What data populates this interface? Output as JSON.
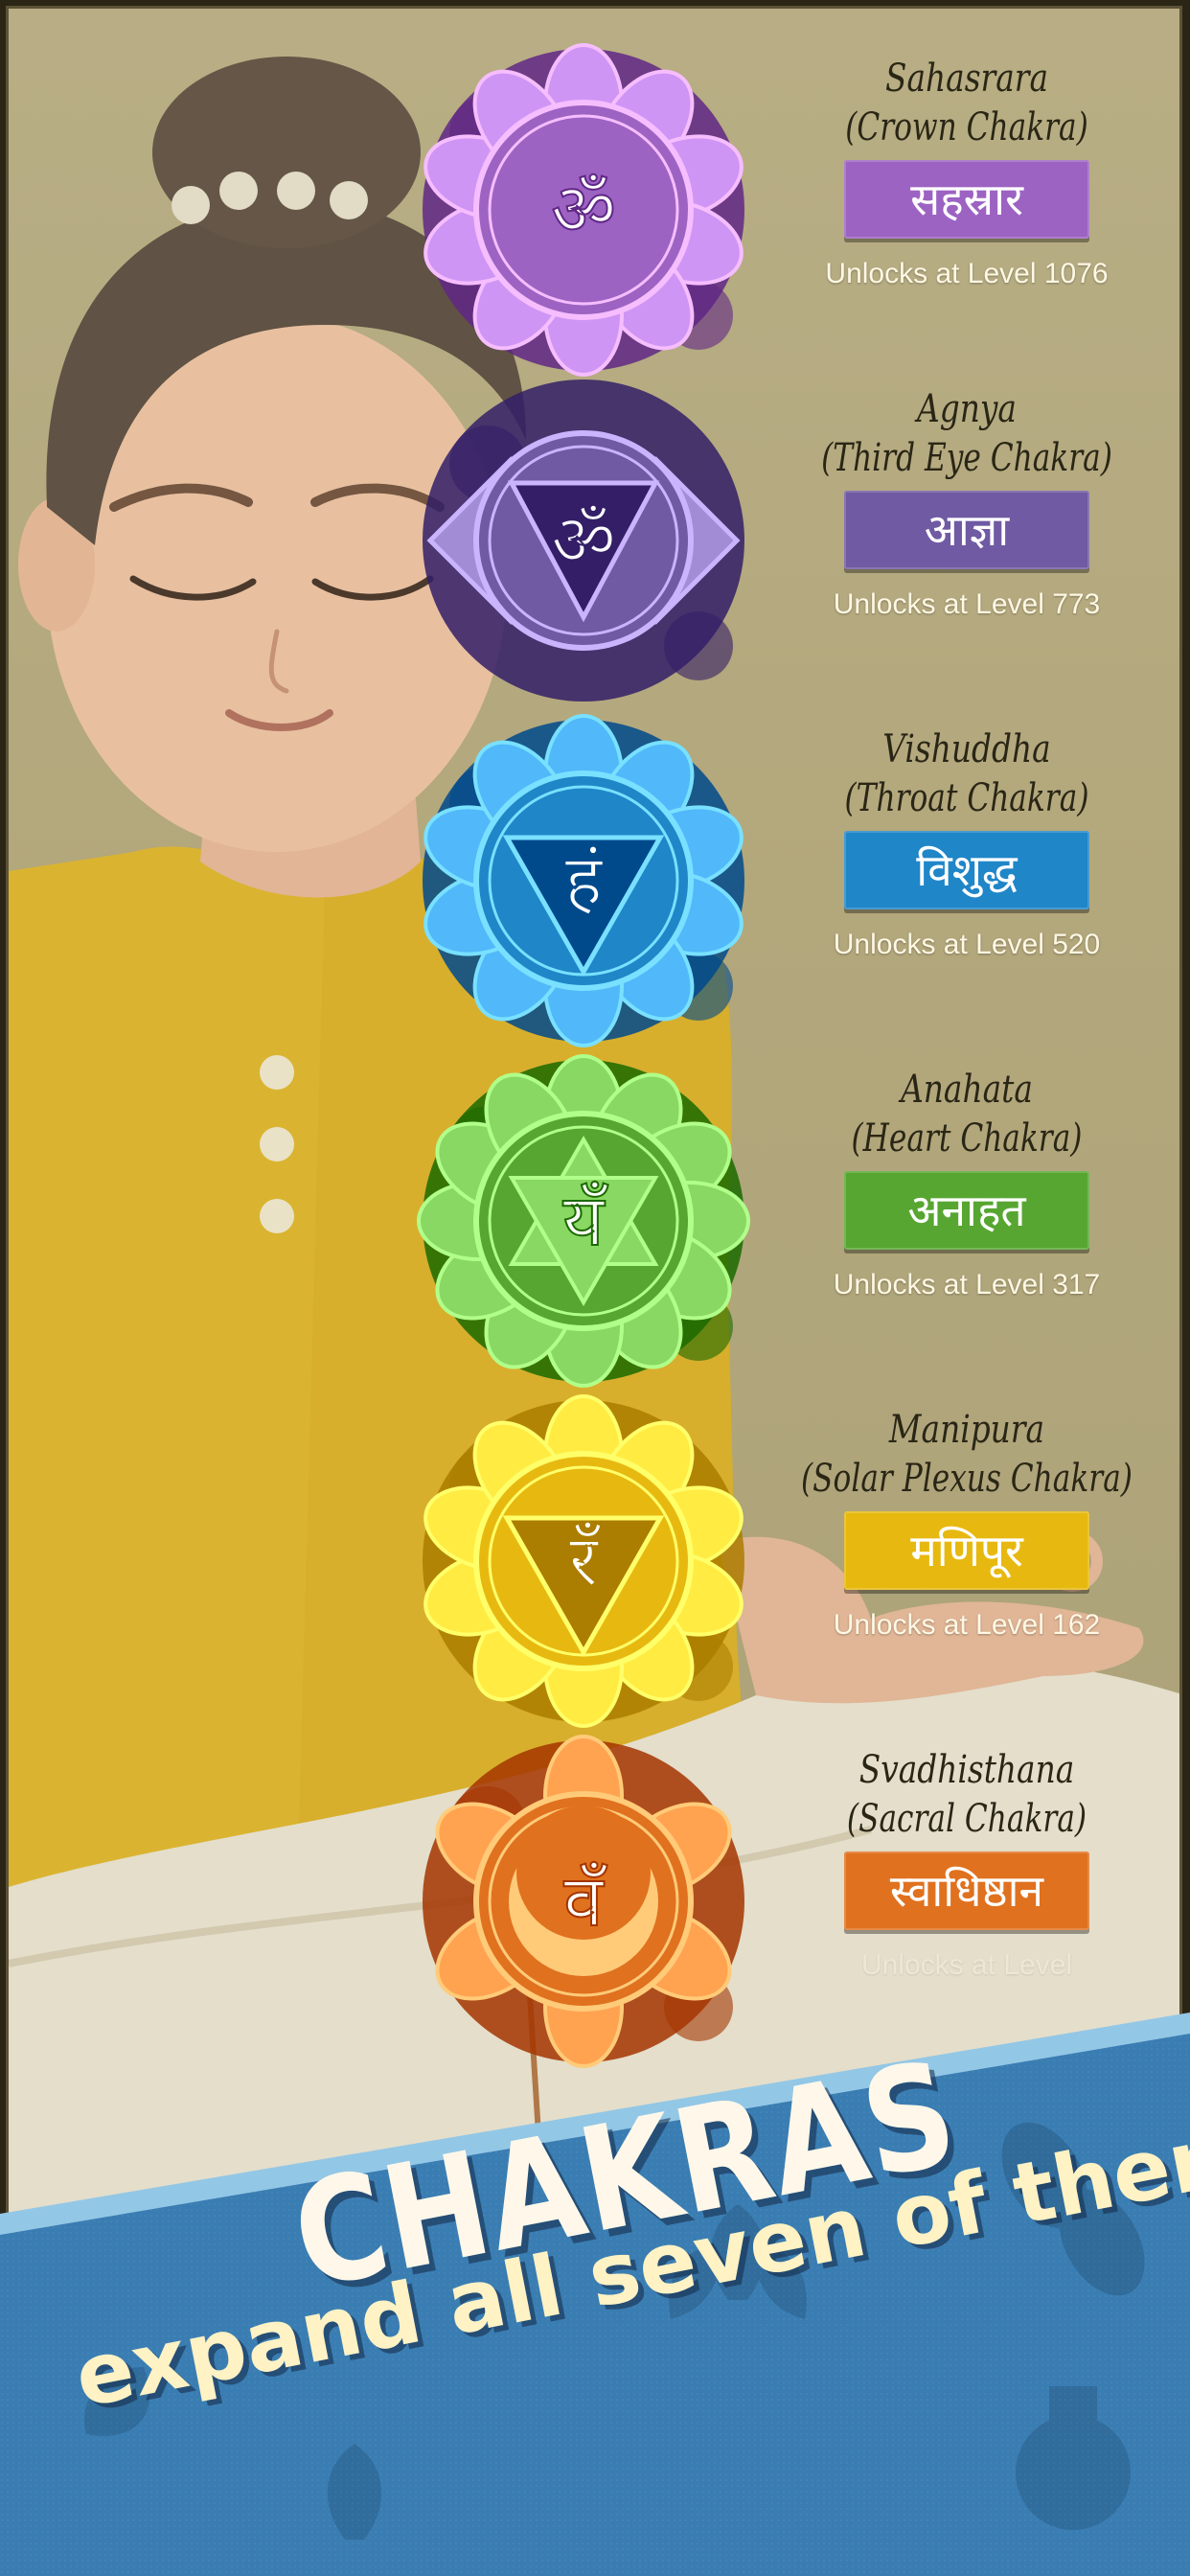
{
  "colors": {
    "banner_blue": "#3b7fb3",
    "banner_edge": "#93c7e6",
    "crown": "#9c63c2",
    "third_eye": "#6f5aa3",
    "throat": "#1f86c8",
    "heart": "#57a631",
    "solar": "#e7b910",
    "sacral": "#e0711f"
  },
  "chakras": [
    {
      "name": "Sahasrara",
      "subtitle": "(Crown Chakra)",
      "sanskrit": "सहस्रार",
      "unlock": "Unlocks at Level 1076",
      "symbol": "ॐ",
      "color": "#9c63c2",
      "icon": "crown-chakra-icon"
    },
    {
      "name": "Agnya",
      "subtitle": "(Third Eye Chakra)",
      "sanskrit": "आज्ञा",
      "unlock": "Unlocks at Level 773",
      "symbol": "ॐ",
      "color": "#6f5aa3",
      "icon": "third-eye-chakra-icon"
    },
    {
      "name": "Vishuddha",
      "subtitle": "(Throat Chakra)",
      "sanskrit": "विशुद्ध",
      "unlock": "Unlocks at Level 520",
      "symbol": "हं",
      "color": "#1f86c8",
      "icon": "throat-chakra-icon"
    },
    {
      "name": "Anahata",
      "subtitle": "(Heart Chakra)",
      "sanskrit": "अनाहत",
      "unlock": "Unlocks at Level 317",
      "symbol": "यँ",
      "color": "#57a631",
      "icon": "heart-chakra-icon"
    },
    {
      "name": "Manipura",
      "subtitle": "(Solar Plexus Chakra)",
      "sanskrit": "मणिपूर",
      "unlock": "Unlocks at Level 162",
      "symbol": "रँ",
      "color": "#e7b910",
      "icon": "solar-plexus-chakra-icon"
    },
    {
      "name": "Svadhisthana",
      "subtitle": "(Sacral Chakra)",
      "sanskrit": "स्वाधिष्ठान",
      "unlock": "Unlocks at Level",
      "symbol": "वँ",
      "color": "#e0711f",
      "icon": "sacral-chakra-icon"
    }
  ],
  "banner": {
    "title": "CHAKRAS",
    "subtitle": "expand all seven of them"
  }
}
